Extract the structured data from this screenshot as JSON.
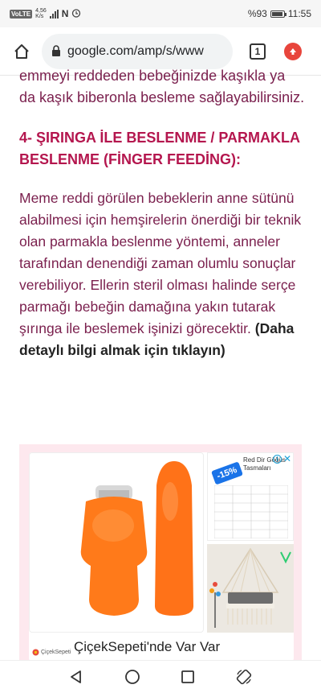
{
  "status_bar": {
    "carrier_badge": "VoLTE",
    "network_speed": "4,56",
    "network_unit": "K/s",
    "battery": "%93",
    "battery_level": 0.93,
    "time": "11:55"
  },
  "browser": {
    "url": "google.com/amp/s/www",
    "tab_count": "1"
  },
  "article": {
    "top_paragraph": "emmeyi reddeden bebeğinizde kaşıkla ya da kaşık biberonla besleme sağlayabilirsiniz.",
    "heading": "4- ŞIRINGA İLE BESLENME / PARMAKLA BESLENME (FİNGER FEEDİNG):",
    "body": "Meme reddi görülen bebeklerin anne sütünü alabilmesi için hemşirelerin önerdiği bir teknik olan parmakla beslenme yöntemi, anneler tarafından denendiği zaman olumlu sonuçlar verebiliyor. Ellerin steril olması halinde serçe parmağı bebeğin damağına yakın tutarak şırınga ile beslemek işinizi görecektir.",
    "link_text": "(Daha detaylı bilgi almak için tıklayın)"
  },
  "ad": {
    "title": "ÇiçekSepeti'nde Var Var",
    "logo_text": "ÇiçekSepeti",
    "discount_badge": "-15%",
    "side_label": "Red Dir Göğüs Tasmaları",
    "info_icon": "i",
    "close_icon": "✕"
  },
  "colors": {
    "body_text": "#7a1f4d",
    "heading": "#b4164e",
    "ad_background": "#fde8ee",
    "update_button": "#e8453c"
  }
}
